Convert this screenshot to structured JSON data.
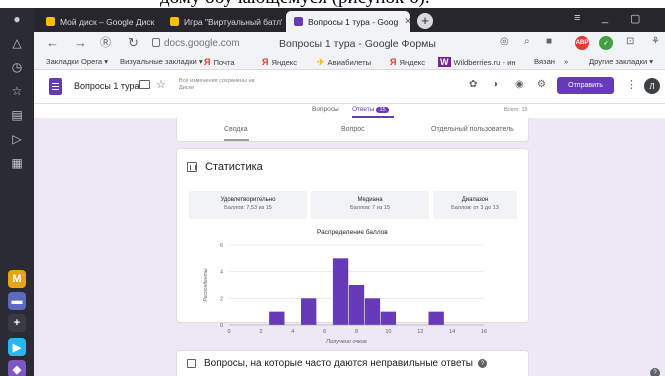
{
  "doc_caption": "дому обучающемуся (рисунок 6).",
  "tabs": [
    {
      "title": "Мой диск – Google Диск",
      "color": "#fbbc04"
    },
    {
      "title": "Игра \"Виртуальный батл\"",
      "color": "#fbbc04"
    },
    {
      "title": "Вопросы 1 тура - Goog",
      "color": "#673ab7"
    }
  ],
  "address": {
    "url": "docs.google.com",
    "page_title": "Вопросы 1 тура - Google Формы"
  },
  "extensions": {
    "abp": "ABP"
  },
  "bookmarks": [
    "Закладки Opera ▾",
    "Визуальные закладки ▾",
    "Почта",
    "Яндекс",
    "Авиабилеты",
    "Яндекс",
    "Wildberries.ru - ин",
    "Вязан",
    "»",
    "Другие закладки ▾"
  ],
  "yandex_letter": "Я",
  "form_header": {
    "title": "Вопросы 1 тура",
    "saved_note": "Все изменения сохранены на Диске",
    "send_label": "Отправить",
    "avatar": "Л"
  },
  "form_tabs": {
    "questions": "Вопросы",
    "answers": "Ответы",
    "answers_count": "15",
    "points": "Всего: 15"
  },
  "subtabs": {
    "summary": "Сводка",
    "question": "Вопрос",
    "individual": "Отдельный пользователь"
  },
  "stats": {
    "title": "Статистика",
    "boxes": [
      {
        "label": "Удовлетворительно",
        "value": "Баллов: 7,53 из 15"
      },
      {
        "label": "Медиана",
        "value": "Баллов: 7 из 15"
      },
      {
        "label": "Диапазон",
        "value": "Баллов: от 3 до 13"
      }
    ]
  },
  "chart_data": {
    "type": "bar",
    "title": "Распределение баллов",
    "xlabel": "Получено очков",
    "ylabel": "Респонденты",
    "x": [
      3,
      5,
      7,
      8,
      9,
      10,
      13
    ],
    "values": [
      1,
      2,
      5,
      3,
      2,
      1,
      1
    ],
    "xlim": [
      0,
      16
    ],
    "ylim": [
      0,
      6
    ],
    "x_ticks": [
      0,
      2,
      4,
      6,
      8,
      10,
      12,
      14,
      16
    ],
    "y_ticks": [
      0,
      2,
      4,
      6
    ],
    "bar_color": "#673ab7"
  },
  "questions_card": {
    "title": "Вопросы, на которые часто даются неправильные ответы"
  },
  "colors": {
    "accent": "#673ab7",
    "page_bg": "#ede7f6"
  }
}
